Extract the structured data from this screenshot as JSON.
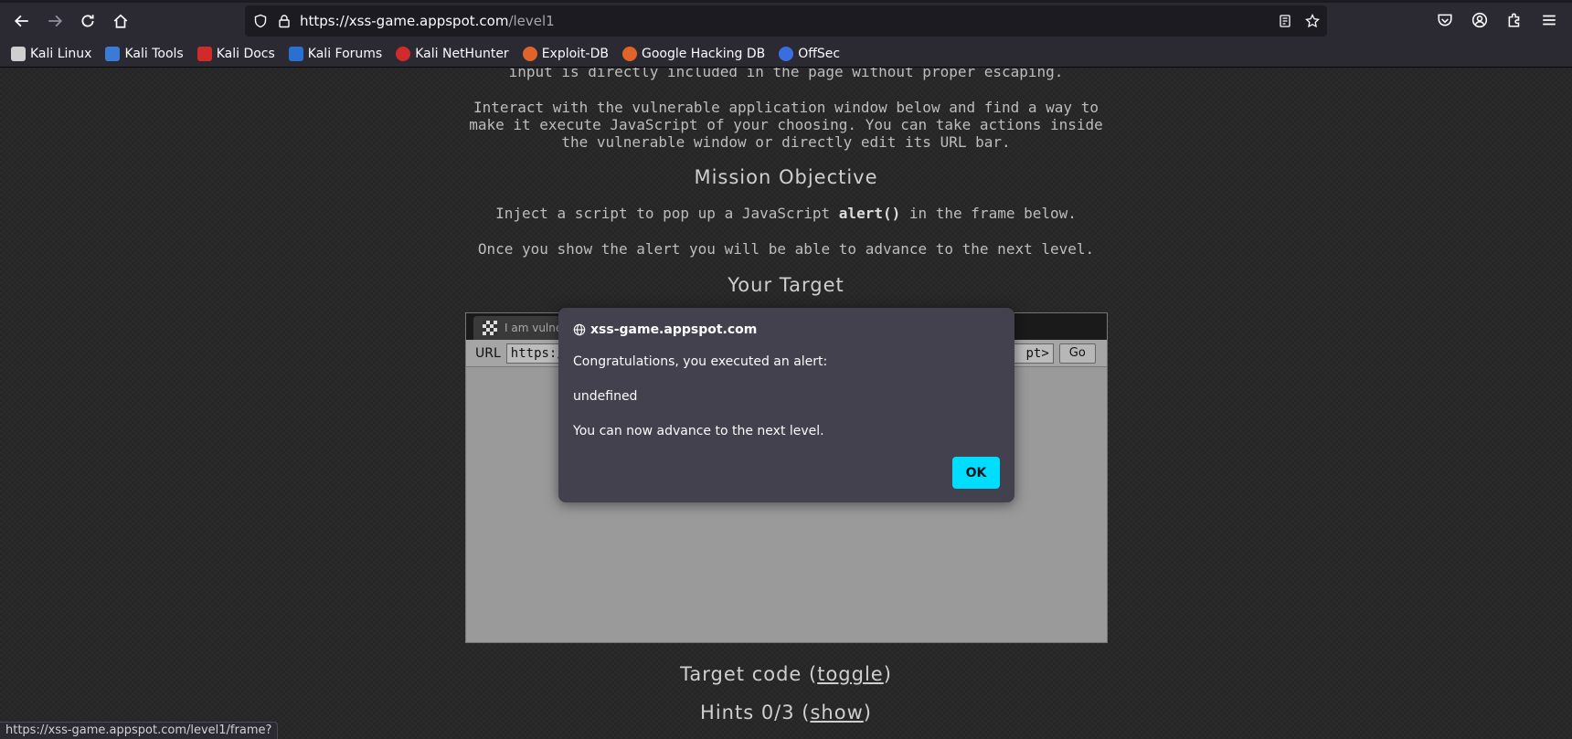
{
  "browser": {
    "url_host": "https://xss-game.appspot.com",
    "url_path": "/level1",
    "status_url": "https://xss-game.appspot.com/level1/frame?"
  },
  "bookmarks": [
    {
      "label": "Kali Linux",
      "icon": "kali-dragon-icon",
      "color": "#cfcfcf"
    },
    {
      "label": "Kali Tools",
      "icon": "kali-tools-icon",
      "color": "#3a7bd5"
    },
    {
      "label": "Kali Docs",
      "icon": "kali-docs-icon",
      "color": "#d12a2a"
    },
    {
      "label": "Kali Forums",
      "icon": "kali-forums-icon",
      "color": "#2a6fd1"
    },
    {
      "label": "Kali NetHunter",
      "icon": "nethunter-icon",
      "color": "#d12a2a"
    },
    {
      "label": "Exploit-DB",
      "icon": "exploit-db-icon",
      "color": "#e0642a"
    },
    {
      "label": "Google Hacking DB",
      "icon": "ghdb-icon",
      "color": "#e0642a"
    },
    {
      "label": "OffSec",
      "icon": "offsec-icon",
      "color": "#3a6ee0"
    }
  ],
  "content": {
    "intro_cut": "input is directly included in the page without proper escaping.",
    "intro_1": "Interact with the vulnerable application window below and find a way to",
    "intro_2": "make it execute JavaScript of your choosing. You can take actions inside",
    "intro_3": "the vulnerable window or directly edit its URL bar.",
    "mission_heading": "Mission Objective",
    "objective_pre": "Inject a script to pop up a JavaScript ",
    "objective_code": "alert()",
    "objective_post": " in the frame below.",
    "advance": "Once you show the alert you will be able to advance to the next level.",
    "target_heading": "Your Target",
    "target_code_label": "Target code (",
    "target_code_link": "toggle",
    "target_code_close": ")",
    "hints_label": "Hints 0/3 (",
    "hints_link": "show",
    "hints_close": ")"
  },
  "frame": {
    "tab_label": "I am vulnera",
    "url_label": "URL",
    "url_value_start": "https:/",
    "url_value_end": "pt>",
    "go_label": "Go"
  },
  "dialog": {
    "origin": "xss-game.appspot.com",
    "line1": "Congratulations, you executed an alert:",
    "line2": "undefined",
    "line3": "You can now advance to the next level.",
    "ok_label": "OK",
    "ok_color": "#00ddff"
  }
}
